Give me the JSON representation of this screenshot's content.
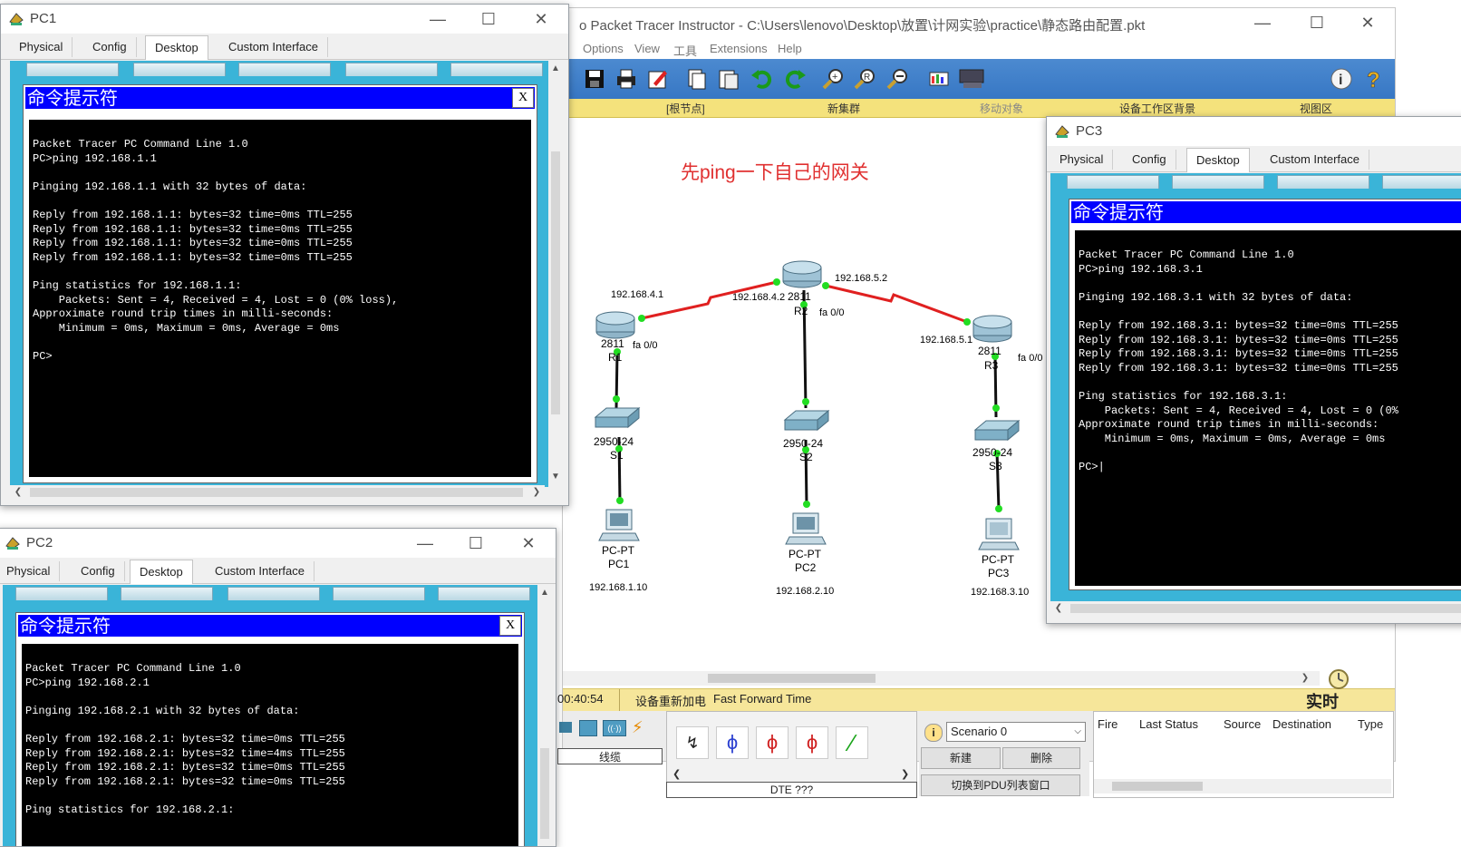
{
  "main_window": {
    "title": "Packet Tracer Instructor - C:\\Users\\lenovo\\Desktop\\放置\\计网实验\\practice\\静态路由配置.pkt",
    "title_prefix": "o",
    "menu": [
      "Options",
      "View",
      "工具",
      "Extensions",
      "Help"
    ],
    "workspace_bar": [
      "[根节点]",
      "新集群",
      "移动对象",
      "设备工作区背景",
      "视图区"
    ],
    "annotation": "先ping一下自己的网关",
    "status": {
      "time": "00:40:54",
      "power_cycle": "设备重新加电",
      "mode": "Fast Forward Time",
      "realtime": "实时"
    },
    "bottom": {
      "connections_label": "线缆",
      "connection_type": "DTE ???",
      "scenario": "Scenario 0",
      "new_button": "新建",
      "delete_button": "删除",
      "pdu_toggle": "切换到PDU列表窗口",
      "pdu_columns": [
        "Fire",
        "Last Status",
        "Source",
        "Destination",
        "Type"
      ]
    }
  },
  "topology": {
    "routers": [
      {
        "model": "2811",
        "name": "R1",
        "ip_wan": "192.168.4.1",
        "port": "fa 0/0"
      },
      {
        "model": "2811",
        "name": "R2",
        "ip_wan_left": "192.168.4.2",
        "ip_wan_right": "192.168.5.2",
        "port": "fa 0/0"
      },
      {
        "model": "2811",
        "name": "R3",
        "ip_wan": "192.168.5.1",
        "port": "fa 0/0"
      }
    ],
    "switches": [
      {
        "model": "2950-24",
        "name": "S1"
      },
      {
        "model": "2950-24",
        "name": "S2"
      },
      {
        "model": "2950-24",
        "name": "S3"
      }
    ],
    "pcs": [
      {
        "model": "PC-PT",
        "name": "PC1",
        "ip": "192.168.1.10"
      },
      {
        "model": "PC-PT",
        "name": "PC2",
        "ip": "192.168.2.10"
      },
      {
        "model": "PC-PT",
        "name": "PC3",
        "ip": "192.168.3.10"
      }
    ]
  },
  "pc_tabs": [
    "Physical",
    "Config",
    "Desktop",
    "Custom Interface"
  ],
  "cmd_title": "命令提示符",
  "cmd_close": "X",
  "pc1": {
    "title": "PC1",
    "lines": [
      "Packet Tracer PC Command Line 1.0",
      "PC>ping 192.168.1.1",
      "",
      "Pinging 192.168.1.1 with 32 bytes of data:",
      "",
      "Reply from 192.168.1.1: bytes=32 time=0ms TTL=255",
      "Reply from 192.168.1.1: bytes=32 time=0ms TTL=255",
      "Reply from 192.168.1.1: bytes=32 time=0ms TTL=255",
      "Reply from 192.168.1.1: bytes=32 time=0ms TTL=255",
      "",
      "Ping statistics for 192.168.1.1:",
      "    Packets: Sent = 4, Received = 4, Lost = 0 (0% loss),",
      "Approximate round trip times in milli-seconds:",
      "    Minimum = 0ms, Maximum = 0ms, Average = 0ms",
      "",
      "PC>"
    ]
  },
  "pc2": {
    "title": "PC2",
    "lines": [
      "Packet Tracer PC Command Line 1.0",
      "PC>ping 192.168.2.1",
      "",
      "Pinging 192.168.2.1 with 32 bytes of data:",
      "",
      "Reply from 192.168.2.1: bytes=32 time=0ms TTL=255",
      "Reply from 192.168.2.1: bytes=32 time=4ms TTL=255",
      "Reply from 192.168.2.1: bytes=32 time=0ms TTL=255",
      "Reply from 192.168.2.1: bytes=32 time=0ms TTL=255",
      "",
      "Ping statistics for 192.168.2.1:"
    ]
  },
  "pc3": {
    "title": "PC3",
    "lines": [
      "Packet Tracer PC Command Line 1.0",
      "PC>ping 192.168.3.1",
      "",
      "Pinging 192.168.3.1 with 32 bytes of data:",
      "",
      "Reply from 192.168.3.1: bytes=32 time=0ms TTL=255",
      "Reply from 192.168.3.1: bytes=32 time=0ms TTL=255",
      "Reply from 192.168.3.1: bytes=32 time=0ms TTL=255",
      "Reply from 192.168.3.1: bytes=32 time=0ms TTL=255",
      "",
      "Ping statistics for 192.168.3.1:",
      "    Packets: Sent = 4, Received = 4, Lost = 0 (0%",
      "Approximate round trip times in milli-seconds:",
      "    Minimum = 0ms, Maximum = 0ms, Average = 0ms",
      "",
      "PC>"
    ]
  },
  "colors": {
    "link_serial": "#e02020",
    "link_ethernet": "#111111",
    "port_up": "#22dd22",
    "annotation": "#e03030",
    "cmd_title_bg": "#0000ff",
    "desktop_bg": "#3ab4d8"
  }
}
